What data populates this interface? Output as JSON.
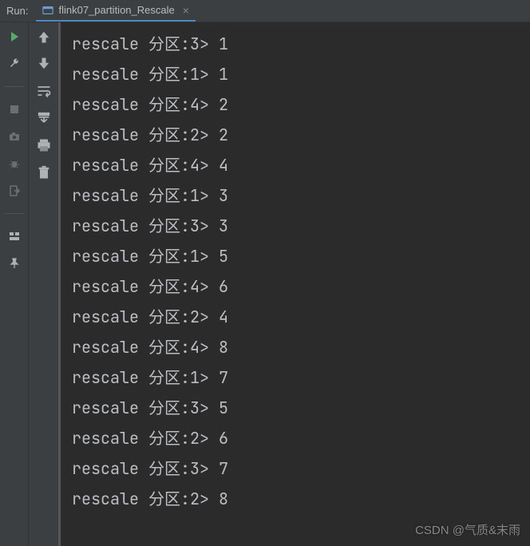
{
  "header": {
    "tool_label": "Run:",
    "tab_name": "flink07_partition_Rescale"
  },
  "icons": {
    "run": "run-icon",
    "wrench": "wrench-icon",
    "stop": "stop-icon",
    "camera": "camera-icon",
    "bug": "bug-icon",
    "exit": "exit-icon",
    "layout": "layout-icon",
    "pin": "pin-icon",
    "up": "up-arrow-icon",
    "down": "down-arrow-icon",
    "wrap": "soft-wrap-icon",
    "scroll": "scroll-to-end-icon",
    "print": "print-icon",
    "trash": "trash-icon",
    "app": "app-icon",
    "close": "close-icon"
  },
  "console": {
    "lines": [
      "rescale 分区:3> 1",
      "rescale 分区:1> 1",
      "rescale 分区:4> 2",
      "rescale 分区:2> 2",
      "rescale 分区:4> 4",
      "rescale 分区:1> 3",
      "rescale 分区:3> 3",
      "rescale 分区:1> 5",
      "rescale 分区:4> 6",
      "rescale 分区:2> 4",
      "rescale 分区:4> 8",
      "rescale 分区:1> 7",
      "rescale 分区:3> 5",
      "rescale 分区:2> 6",
      "rescale 分区:3> 7",
      "rescale 分区:2> 8"
    ]
  },
  "watermark": "CSDN @气质&末雨"
}
